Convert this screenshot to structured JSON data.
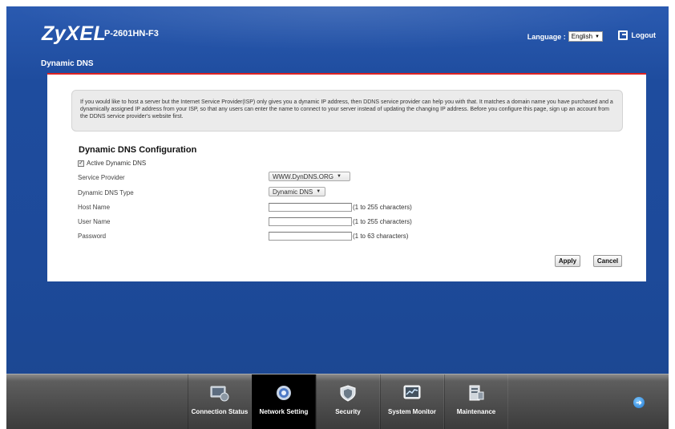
{
  "header": {
    "brand": "ZyXEL",
    "model": "P-2601HN-F3",
    "language_label": "Language :",
    "language_value": "English",
    "logout_label": "Logout"
  },
  "page": {
    "title": "Dynamic DNS"
  },
  "info_text": "If you would like to host a server but the Internet Service Provider(ISP) only gives you a dynamic IP address, then DDNS service provider can help you with that. It matches a domain name you have purchased and a dynamically assigned IP address from your ISP, so that any users can enter the name to connect to your server instead of updating the changing IP address. Before you configure this page, sign up an account from the DDNS service provider's website first.",
  "config": {
    "title": "Dynamic DNS Configuration",
    "active_label": "Active Dynamic DNS",
    "active_checked": true,
    "service_provider_label": "Service Provider",
    "service_provider_value": "WWW.DynDNS.ORG",
    "ddns_type_label": "Dynamic DNS Type",
    "ddns_type_value": "Dynamic DNS",
    "host_name_label": "Host Name",
    "host_name_value": "",
    "host_name_hint": "(1 to 255 characters)",
    "user_name_label": "User Name",
    "user_name_value": "",
    "user_name_hint": "(1 to 255 characters)",
    "password_label": "Password",
    "password_value": "",
    "password_hint": "(1 to 63 characters)"
  },
  "buttons": {
    "apply": "Apply",
    "cancel": "Cancel"
  },
  "nav": [
    {
      "label": "Connection Status",
      "icon": "connection-status-icon"
    },
    {
      "label": "Network Setting",
      "icon": "network-setting-icon",
      "active": true
    },
    {
      "label": "Security",
      "icon": "security-shield-icon"
    },
    {
      "label": "System Monitor",
      "icon": "system-monitor-icon"
    },
    {
      "label": "Maintenance",
      "icon": "maintenance-icon"
    }
  ],
  "colors": {
    "accent_red": "#dd2222",
    "background_blue": "#1e4c9e"
  }
}
